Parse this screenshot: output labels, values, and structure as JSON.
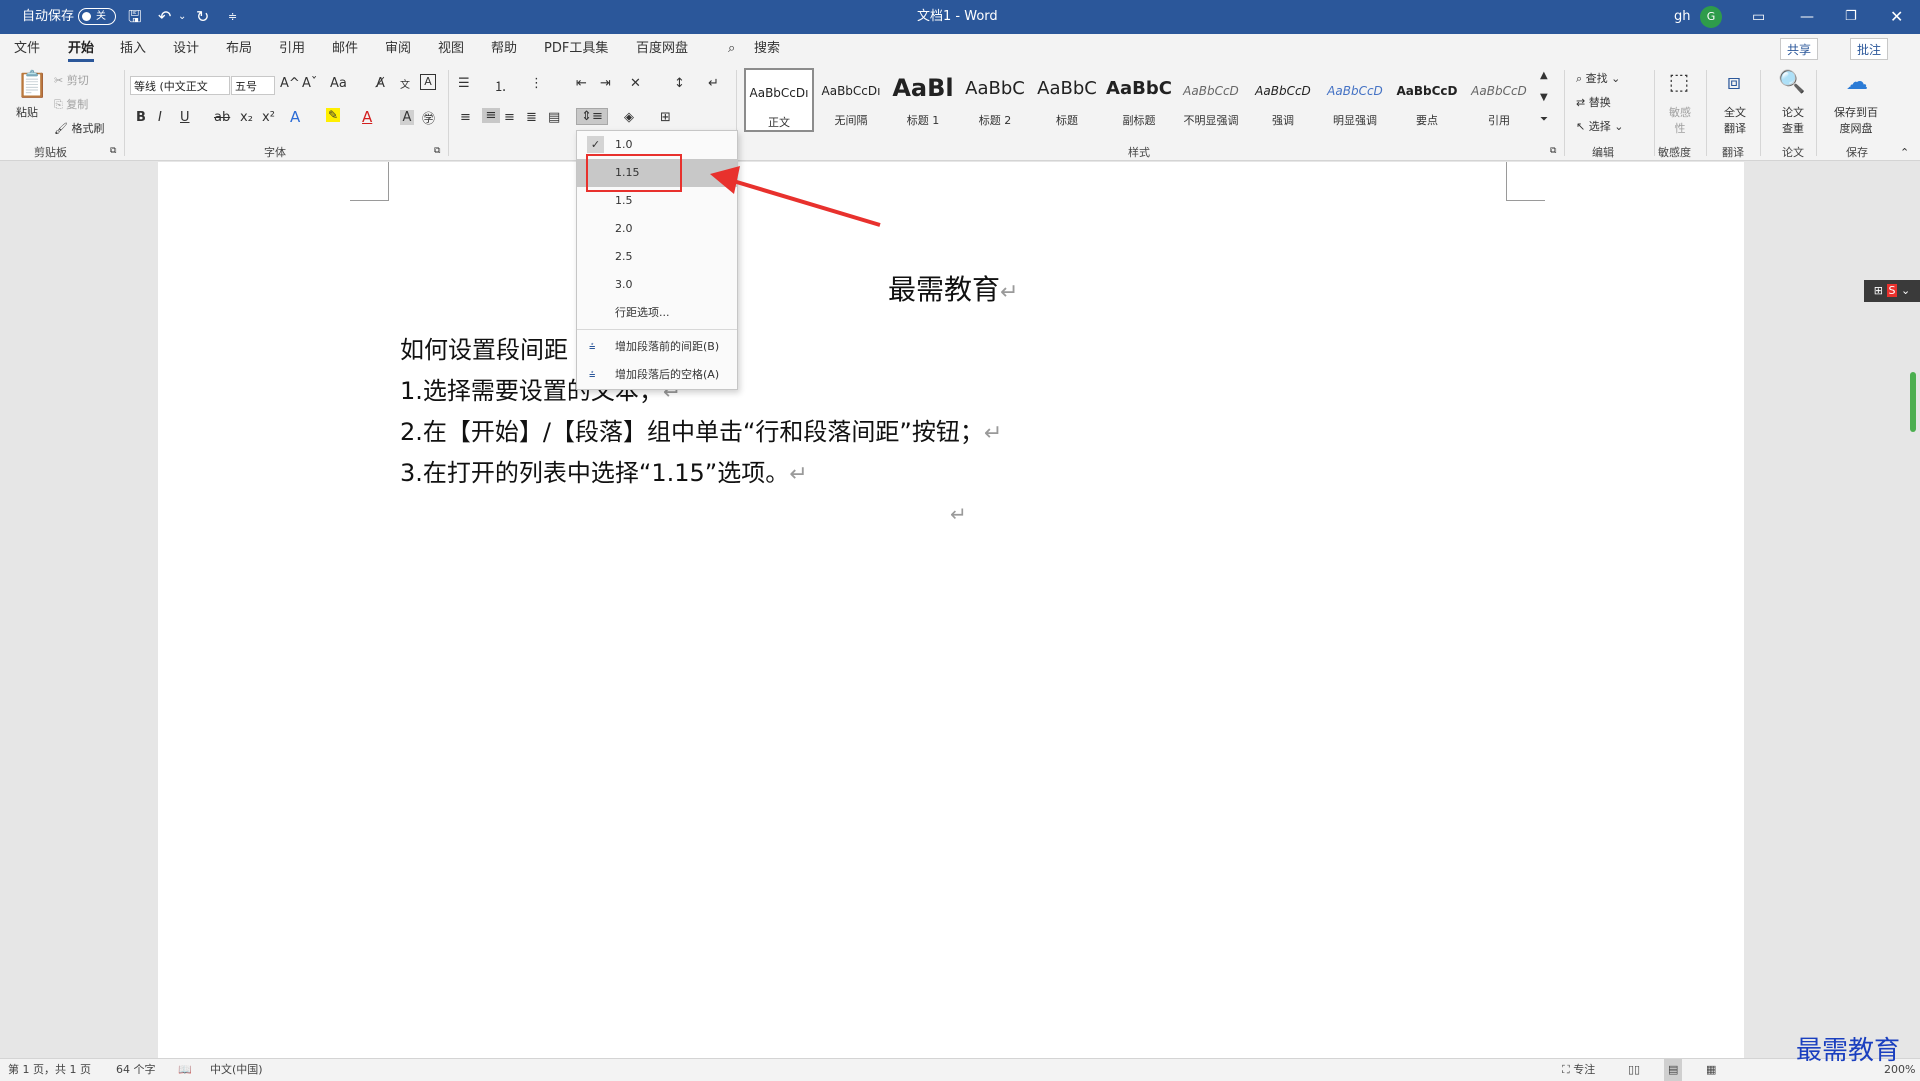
{
  "titlebar": {
    "autosave_label": "自动保存",
    "autosave_state": "关",
    "doc_title": "文档1  -  Word",
    "user_initials": "gh",
    "avatar_letter": "G"
  },
  "tabs": [
    "文件",
    "开始",
    "插入",
    "设计",
    "布局",
    "引用",
    "邮件",
    "审阅",
    "视图",
    "帮助",
    "PDF工具集",
    "百度网盘"
  ],
  "search_label": "搜索",
  "share_label": "共享",
  "comment_label": "批注",
  "clipboard": {
    "paste": "粘贴",
    "cut": "剪切",
    "copy": "复制",
    "format_painter": "格式刷",
    "group": "剪贴板"
  },
  "font": {
    "name": "等线 (中文正文",
    "size": "五号",
    "group": "字体"
  },
  "styles": {
    "group": "样式",
    "items": [
      {
        "preview": "AaBbCcDı",
        "name": "正文"
      },
      {
        "preview": "AaBbCcDı",
        "name": "无间隔"
      },
      {
        "preview": "AaBl",
        "name": "标题 1"
      },
      {
        "preview": "AaBbC",
        "name": "标题 2"
      },
      {
        "preview": "AaBbC",
        "name": "标题"
      },
      {
        "preview": "AaBbC",
        "name": "副标题"
      },
      {
        "preview": "AaBbCcD",
        "name": "不明显强调"
      },
      {
        "preview": "AaBbCcD",
        "name": "强调"
      },
      {
        "preview": "AaBbCcD",
        "name": "明显强调"
      },
      {
        "preview": "AaBbCcD",
        "name": "要点"
      },
      {
        "preview": "AaBbCcD",
        "name": "引用"
      }
    ]
  },
  "editing": {
    "find": "查找",
    "replace": "替换",
    "select": "选择",
    "group": "编辑"
  },
  "sensitivity": {
    "btn": "敏感性",
    "group": "敏感度"
  },
  "translate": {
    "btn": "全文翻译",
    "group": "翻译"
  },
  "paper": {
    "btn": "论文查重",
    "group": "论文"
  },
  "save": {
    "btn": "保存到百度网盘",
    "group": "保存"
  },
  "line_spacing_menu": {
    "options": [
      "1.0",
      "1.15",
      "1.5",
      "2.0",
      "2.5",
      "3.0"
    ],
    "checked": "1.0",
    "selected": "1.15",
    "more": "行距选项...",
    "add_before": "增加段落前的间距(B)",
    "add_after": "增加段落后的空格(A)"
  },
  "document": {
    "title": "最需教育",
    "lines": [
      "如何设置段间距",
      "1.选择需要设置的文本；",
      "2.在【开始】/【段落】组中单击“行和段落间距”按钮；",
      "3.在打开的列表中选择“1.15”选项。"
    ],
    "pilcrow": "↵"
  },
  "status": {
    "page": "第 1 页，共 1 页",
    "words": "64 个字",
    "language": "中文(中国)",
    "focus": "专注",
    "zoom": "200%"
  },
  "watermark": "最需教育",
  "colors": {
    "brand": "#2b579a",
    "annotation": "#e8312d"
  }
}
